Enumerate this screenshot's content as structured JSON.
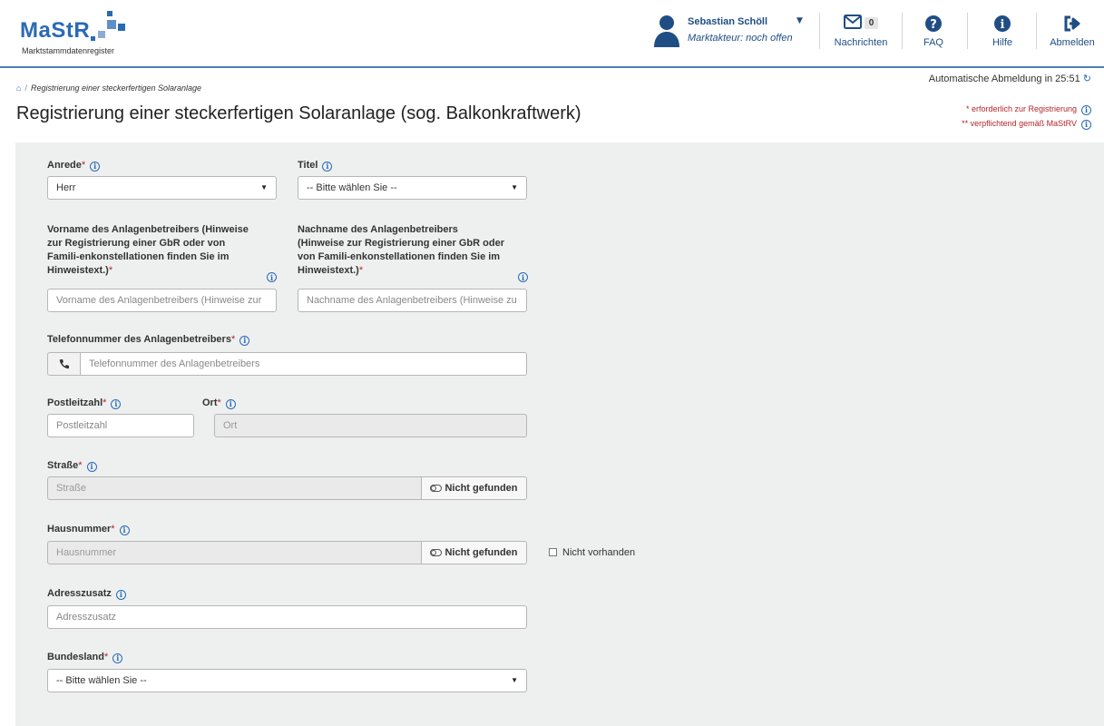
{
  "header": {
    "logo_text": "MaStR",
    "logo_sub": "Marktstammdatenregister",
    "user_name": "Sebastian Schöll",
    "user_role": "Marktakteur: noch offen",
    "nav": {
      "messages_label": "Nachrichten",
      "messages_count": "0",
      "faq_label": "FAQ",
      "help_label": "Hilfe",
      "logout_label": "Abmelden"
    }
  },
  "subheader": {
    "logout_timer": "Automatische Abmeldung in 25:51",
    "breadcrumb_current": "Registrierung einer steckerfertigen Solaranlage",
    "page_title": "Registrierung einer steckerfertigen Solaranlage (sog. Balkonkraftwerk)",
    "legend_required": "* erforderlich zur Registrierung",
    "legend_mandatory": "** verpflichtend gemäß MaStRV"
  },
  "form": {
    "anrede": {
      "label": "Anrede",
      "value": "Herr"
    },
    "titel": {
      "label": "Titel",
      "value": "-- Bitte wählen Sie --"
    },
    "vorname": {
      "label": "Vorname des Anlagenbetreibers (Hinweise zur Registrierung einer GbR oder von Famili-enkonstellationen finden Sie im Hinweistext.)",
      "placeholder": "Vorname des Anlagenbetreibers (Hinweise zur"
    },
    "nachname": {
      "label": "Nachname des Anlagenbetreibers (Hinweise zur Registrierung einer GbR oder von Famili-enkonstellationen finden Sie im Hinweistext.)",
      "placeholder": "Nachname des Anlagenbetreibers (Hinweise zu"
    },
    "telefon": {
      "label": "Telefonnummer des Anlagenbetreibers",
      "placeholder": "Telefonnummer des Anlagenbetreibers"
    },
    "plz": {
      "label": "Postleitzahl",
      "placeholder": "Postleitzahl"
    },
    "ort": {
      "label": "Ort",
      "placeholder": "Ort"
    },
    "strasse": {
      "label": "Straße",
      "placeholder": "Straße",
      "not_found": "Nicht gefunden"
    },
    "hausnummer": {
      "label": "Hausnummer",
      "placeholder": "Hausnummer",
      "not_found": "Nicht gefunden",
      "not_available": "Nicht vorhanden"
    },
    "adresszusatz": {
      "label": "Adresszusatz",
      "placeholder": "Adresszusatz"
    },
    "bundesland": {
      "label": "Bundesland",
      "value": "-- Bitte wählen Sie --"
    },
    "required_mark": "*"
  },
  "colors": {
    "brand": "#2a6ab5",
    "required": "#b3262b",
    "panel": "#eef0f0"
  },
  "icons": [
    "user-icon",
    "envelope-icon",
    "question-circle-icon",
    "info-circle-icon",
    "sign-out-icon",
    "home-icon",
    "refresh-icon",
    "phone-icon",
    "toggle-icon",
    "info-icon",
    "chevron-down-icon"
  ]
}
